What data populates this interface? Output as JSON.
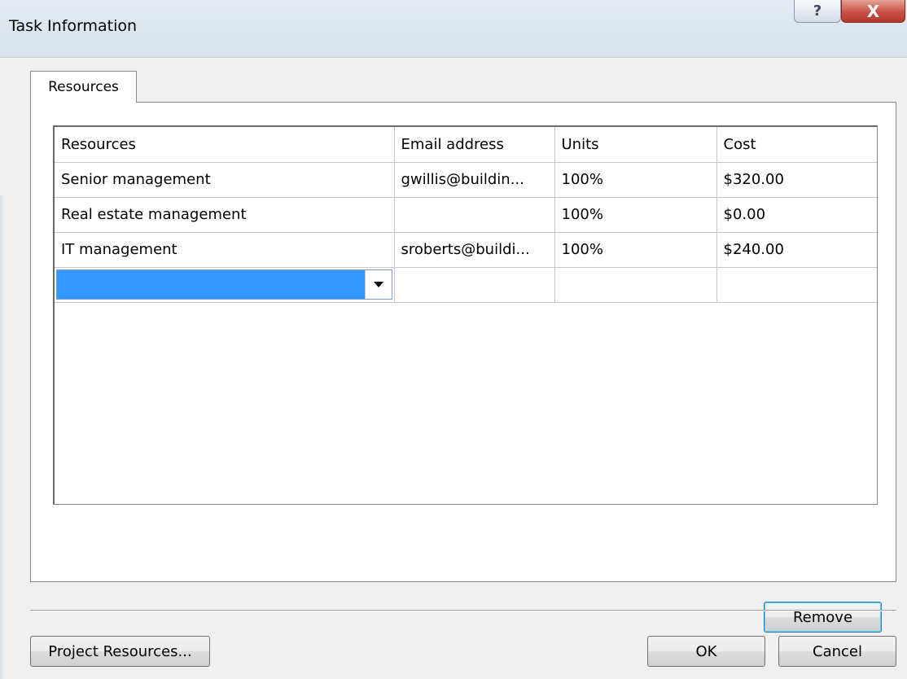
{
  "window": {
    "title": "Task Information",
    "help_glyph": "?",
    "close_glyph": "X"
  },
  "tabs": [
    {
      "label": "Resources",
      "selected": true
    }
  ],
  "grid": {
    "columns": [
      "Resources",
      "Email address",
      "Units",
      "Cost"
    ],
    "rows": [
      {
        "resource": "Senior management",
        "email": "gwillis@buildin...",
        "units": "100%",
        "cost": "$320.00"
      },
      {
        "resource": "Real estate management",
        "email": "",
        "units": "100%",
        "cost": "$0.00"
      },
      {
        "resource": "IT management",
        "email": "sroberts@buildi...",
        "units": "100%",
        "cost": "$240.00"
      }
    ],
    "new_row_selected_value": ""
  },
  "buttons": {
    "remove": "Remove",
    "project_resources": "Project Resources...",
    "ok": "OK",
    "cancel": "Cancel"
  },
  "colors": {
    "selection": "#3399ff",
    "close_button": "#c75044"
  }
}
